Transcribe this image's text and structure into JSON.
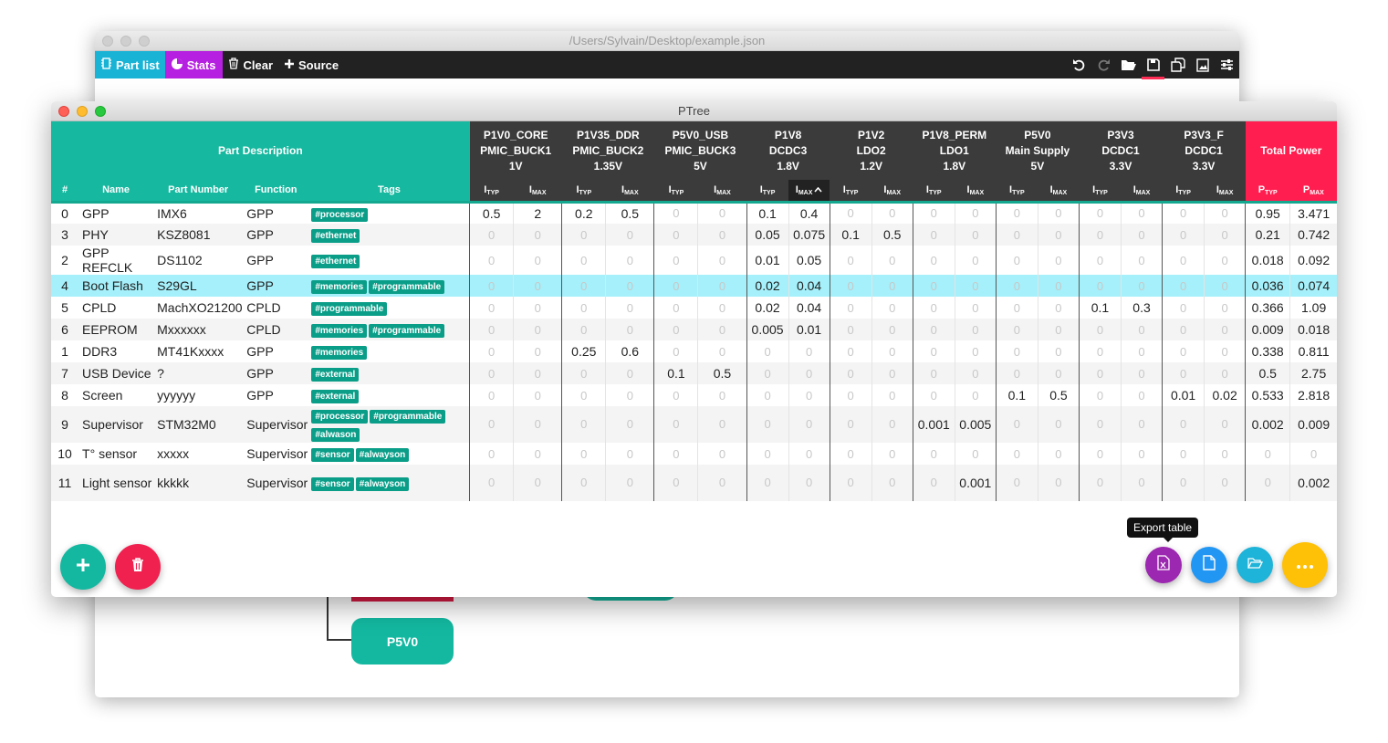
{
  "bg_window": {
    "title": "/Users/Sylvain/Desktop/example.json",
    "toolbar": {
      "part_list": "Part list",
      "stats": "Stats",
      "clear": "Clear",
      "source": "Source",
      "part_list_color": "#19b3d6",
      "stats_color": "#b620e0"
    },
    "diagram": {
      "node_label": "P5V0"
    }
  },
  "window": {
    "title": "PTree"
  },
  "header": {
    "part_description": "Part Description",
    "cols": {
      "idx": "#",
      "name": "Name",
      "part_number": "Part Number",
      "function": "Function",
      "tags": "Tags"
    },
    "rails": [
      {
        "l1": "P1V0_CORE",
        "l2": "PMIC_BUCK1",
        "l3": "1V"
      },
      {
        "l1": "P1V35_DDR",
        "l2": "PMIC_BUCK2",
        "l3": "1.35V"
      },
      {
        "l1": "P5V0_USB",
        "l2": "PMIC_BUCK3",
        "l3": "5V"
      },
      {
        "l1": "P1V8",
        "l2": "DCDC3",
        "l3": "1.8V"
      },
      {
        "l1": "P1V2",
        "l2": "LDO2",
        "l3": "1.2V"
      },
      {
        "l1": "P1V8_PERM",
        "l2": "LDO1",
        "l3": "1.8V"
      },
      {
        "l1": "P5V0",
        "l2": "Main Supply",
        "l3": "5V"
      },
      {
        "l1": "P3V3",
        "l2": "DCDC1",
        "l3": "3.3V"
      },
      {
        "l1": "P3V3_F",
        "l2": "DCDC1",
        "l3": "3.3V"
      }
    ],
    "total_power": "Total Power",
    "i_label": "I",
    "p_label": "P",
    "typ_sub": "TYP",
    "max_sub": "MAX"
  },
  "rows": [
    {
      "idx": "0",
      "name": "GPP",
      "part_number": "IMX6",
      "function": "GPP",
      "tags": [
        "#processor"
      ],
      "vals": [
        "0.5",
        "2",
        "0.2",
        "0.5",
        "0",
        "0",
        "0.1",
        "0.4",
        "0",
        "0",
        "0",
        "0",
        "0",
        "0",
        "0",
        "0",
        "0",
        "0"
      ],
      "ptyp": "0.95",
      "pmax": "3.471"
    },
    {
      "idx": "3",
      "name": "PHY",
      "part_number": "KSZ8081",
      "function": "GPP",
      "tags": [
        "#ethernet"
      ],
      "vals": [
        "0",
        "0",
        "0",
        "0",
        "0",
        "0",
        "0.05",
        "0.075",
        "0.1",
        "0.5",
        "0",
        "0",
        "0",
        "0",
        "0",
        "0",
        "0",
        "0"
      ],
      "ptyp": "0.21",
      "pmax": "0.742"
    },
    {
      "idx": "2",
      "name": "GPP REFCLK",
      "part_number": "DS1102",
      "function": "GPP",
      "tags": [
        "#ethernet"
      ],
      "vals": [
        "0",
        "0",
        "0",
        "0",
        "0",
        "0",
        "0.01",
        "0.05",
        "0",
        "0",
        "0",
        "0",
        "0",
        "0",
        "0",
        "0",
        "0",
        "0"
      ],
      "ptyp": "0.018",
      "pmax": "0.092"
    },
    {
      "idx": "4",
      "name": "Boot Flash",
      "part_number": "S29GL",
      "function": "GPP",
      "tags": [
        "#memories",
        "#programmable"
      ],
      "vals": [
        "0",
        "0",
        "0",
        "0",
        "0",
        "0",
        "0.02",
        "0.04",
        "0",
        "0",
        "0",
        "0",
        "0",
        "0",
        "0",
        "0",
        "0",
        "0"
      ],
      "ptyp": "0.036",
      "pmax": "0.074"
    },
    {
      "idx": "5",
      "name": "CPLD",
      "part_number": "MachXO21200",
      "function": "CPLD",
      "tags": [
        "#programmable"
      ],
      "vals": [
        "0",
        "0",
        "0",
        "0",
        "0",
        "0",
        "0.02",
        "0.04",
        "0",
        "0",
        "0",
        "0",
        "0",
        "0",
        "0.1",
        "0.3",
        "0",
        "0"
      ],
      "ptyp": "0.366",
      "pmax": "1.09"
    },
    {
      "idx": "6",
      "name": "EEPROM",
      "part_number": "Mxxxxxx",
      "function": "CPLD",
      "tags": [
        "#memories",
        "#programmable"
      ],
      "vals": [
        "0",
        "0",
        "0",
        "0",
        "0",
        "0",
        "0.005",
        "0.01",
        "0",
        "0",
        "0",
        "0",
        "0",
        "0",
        "0",
        "0",
        "0",
        "0"
      ],
      "ptyp": "0.009",
      "pmax": "0.018"
    },
    {
      "idx": "1",
      "name": "DDR3",
      "part_number": "MT41Kxxxx",
      "function": "GPP",
      "tags": [
        "#memories"
      ],
      "vals": [
        "0",
        "0",
        "0.25",
        "0.6",
        "0",
        "0",
        "0",
        "0",
        "0",
        "0",
        "0",
        "0",
        "0",
        "0",
        "0",
        "0",
        "0",
        "0"
      ],
      "ptyp": "0.338",
      "pmax": "0.811"
    },
    {
      "idx": "7",
      "name": "USB Device",
      "part_number": "?",
      "function": "GPP",
      "tags": [
        "#external"
      ],
      "vals": [
        "0",
        "0",
        "0",
        "0",
        "0.1",
        "0.5",
        "0",
        "0",
        "0",
        "0",
        "0",
        "0",
        "0",
        "0",
        "0",
        "0",
        "0",
        "0"
      ],
      "ptyp": "0.5",
      "pmax": "2.75"
    },
    {
      "idx": "8",
      "name": "Screen",
      "part_number": "yyyyyy",
      "function": "GPP",
      "tags": [
        "#external"
      ],
      "vals": [
        "0",
        "0",
        "0",
        "0",
        "0",
        "0",
        "0",
        "0",
        "0",
        "0",
        "0",
        "0",
        "0.1",
        "0.5",
        "0",
        "0",
        "0.01",
        "0.02"
      ],
      "ptyp": "0.533",
      "pmax": "2.818"
    },
    {
      "idx": "9",
      "name": "Supervisor",
      "part_number": "STM32M0",
      "function": "Supervisor",
      "tags": [
        "#processor",
        "#programmable",
        "#alwason"
      ],
      "vals": [
        "0",
        "0",
        "0",
        "0",
        "0",
        "0",
        "0",
        "0",
        "0",
        "0",
        "0.001",
        "0.005",
        "0",
        "0",
        "0",
        "0",
        "0",
        "0"
      ],
      "ptyp": "0.002",
      "pmax": "0.009"
    },
    {
      "idx": "10",
      "name": "T° sensor",
      "part_number": "xxxxx",
      "function": "Supervisor",
      "tags": [
        "#sensor",
        "#alwayson"
      ],
      "vals": [
        "0",
        "0",
        "0",
        "0",
        "0",
        "0",
        "0",
        "0",
        "0",
        "0",
        "0",
        "0",
        "0",
        "0",
        "0",
        "0",
        "0",
        "0"
      ],
      "ptyp": "0",
      "pmax": "0"
    },
    {
      "idx": "11",
      "name": "Light sensor",
      "part_number": "kkkkk",
      "function": "Supervisor",
      "tags": [
        "#sensor",
        "#alwayson"
      ],
      "vals": [
        "0",
        "0",
        "0",
        "0",
        "0",
        "0",
        "0",
        "0",
        "0",
        "0",
        "0",
        "0.001",
        "0",
        "0",
        "0",
        "0",
        "0",
        "0"
      ],
      "ptyp": "0",
      "pmax": "0.002"
    }
  ],
  "highlighted_row": 3,
  "tooltip": "Export table",
  "colors": {
    "teal": "#16b89f",
    "dark": "#3b3b3b",
    "red": "#ff1e4f",
    "highlight": "#a5f0fa",
    "tag": "#0a9e88",
    "fab_add": "#14b8a0",
    "fab_delete": "#f0204f",
    "fab_export": "#9c27b0",
    "fab_doc": "#2196f3",
    "fab_open": "#1eb3d8",
    "fab_more": "#ffc107"
  }
}
